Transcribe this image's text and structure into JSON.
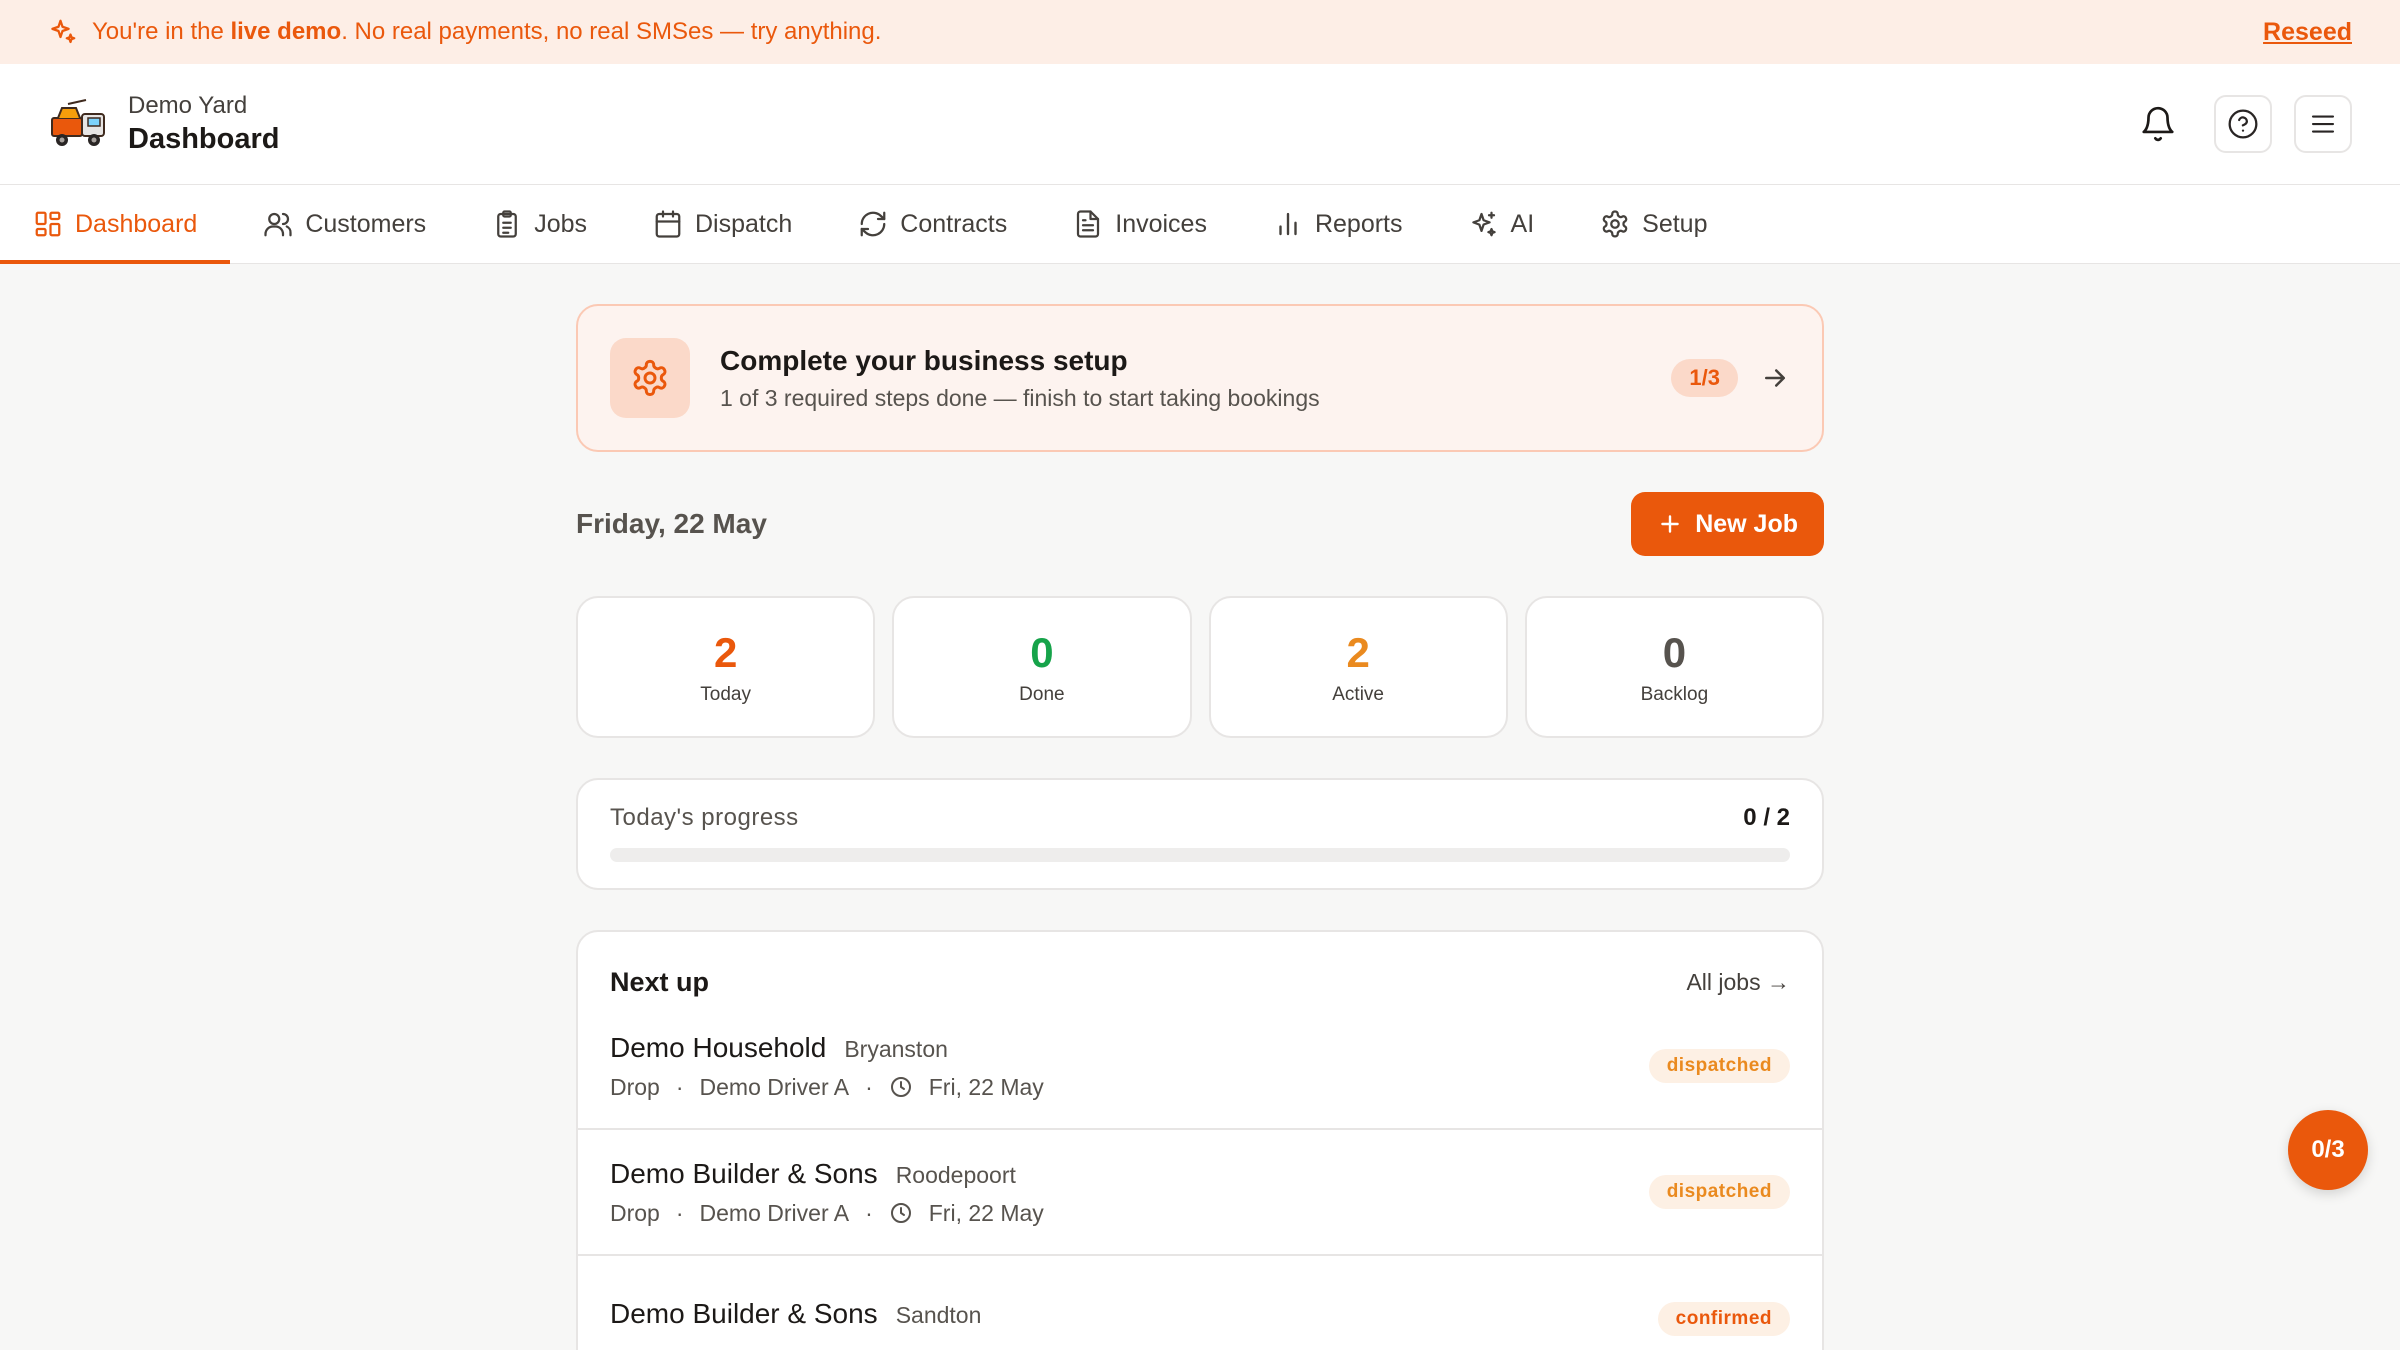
{
  "banner": {
    "prefix": "You're in the ",
    "bold": "live demo",
    "suffix": ". No real payments, no real SMSes — try anything.",
    "action": "Reseed"
  },
  "header": {
    "yard": "Demo Yard",
    "title": "Dashboard"
  },
  "tabs": [
    {
      "label": "Dashboard",
      "icon": "dashboard-icon"
    },
    {
      "label": "Customers",
      "icon": "users-icon"
    },
    {
      "label": "Jobs",
      "icon": "clipboard-icon"
    },
    {
      "label": "Dispatch",
      "icon": "calendar-icon"
    },
    {
      "label": "Contracts",
      "icon": "refresh-icon"
    },
    {
      "label": "Invoices",
      "icon": "document-icon"
    },
    {
      "label": "Reports",
      "icon": "bar-chart-icon"
    },
    {
      "label": "AI",
      "icon": "sparkles-icon"
    },
    {
      "label": "Setup",
      "icon": "gear-icon"
    }
  ],
  "setup": {
    "title": "Complete your business setup",
    "subtitle": "1 of 3 required steps done — finish to start taking bookings",
    "count": "1/3"
  },
  "date": "Friday, 22 May",
  "new_job": "New Job",
  "stats": [
    {
      "value": "2",
      "label": "Today",
      "color": "#ea580c"
    },
    {
      "value": "0",
      "label": "Done",
      "color": "#16a34a"
    },
    {
      "value": "2",
      "label": "Active",
      "color": "#ea8a1f"
    },
    {
      "value": "0",
      "label": "Backlog",
      "color": "#57534e"
    }
  ],
  "progress": {
    "label": "Today's progress",
    "count": "0 / 2",
    "fraction": 0
  },
  "next_up": {
    "title": "Next up",
    "all_jobs": "All jobs →",
    "jobs": [
      {
        "name": "Demo Household",
        "area": "Bryanston",
        "type": "Drop",
        "driver": "Demo Driver A",
        "date": "Fri, 22 May",
        "status": "dispatched"
      },
      {
        "name": "Demo Builder & Sons",
        "area": "Roodepoort",
        "type": "Drop",
        "driver": "Demo Driver A",
        "date": "Fri, 22 May",
        "status": "dispatched"
      },
      {
        "name": "Demo Builder & Sons",
        "area": "Sandton",
        "type": "",
        "driver": "",
        "date": "",
        "status": "confirmed"
      }
    ]
  },
  "fab": "0/3",
  "colors": {
    "accent": "#ea580c",
    "banner_bg": "#fdeee6"
  }
}
